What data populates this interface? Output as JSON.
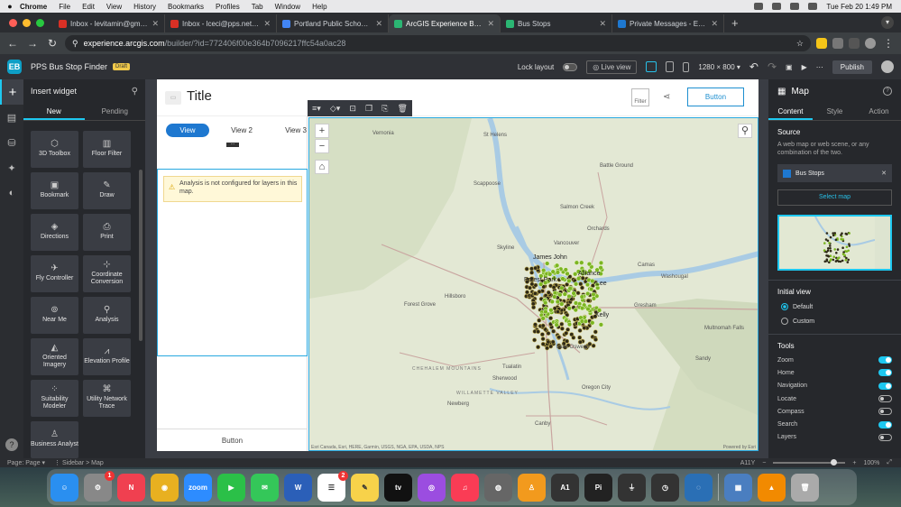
{
  "menubar": {
    "app": "Chrome",
    "menus": [
      "File",
      "Edit",
      "View",
      "History",
      "Bookmarks",
      "Profiles",
      "Tab",
      "Window",
      "Help"
    ],
    "clock": "Tue Feb 20  1:49 PM"
  },
  "tabs": [
    {
      "title": "Inbox - levitamin@gmail.com",
      "color": "#d93025"
    },
    {
      "title": "Inbox - lceci@pps.net - Portl",
      "color": "#d93025"
    },
    {
      "title": "Portland Public Schools - Cal",
      "color": "#4285f4"
    },
    {
      "title": "ArcGIS Experience Builder",
      "color": "#2bb673"
    },
    {
      "title": "Bus Stops",
      "color": "#2bb673"
    },
    {
      "title": "Private Messages - Esri Comm",
      "color": "#1e78d0"
    }
  ],
  "address": {
    "host": "experience.arcgis.com",
    "path": "/builder/?id=772406f00e364b7096217ffc54a0ac28"
  },
  "builder": {
    "app_name": "PPS Bus Stop Finder",
    "draft_label": "Draft",
    "lock_layout_label": "Lock layout",
    "live_view_label": "Live view",
    "resolution": "1280 × 800",
    "publish_label": "Publish"
  },
  "insert": {
    "title": "Insert widget",
    "tab_new": "New",
    "tab_pending": "Pending",
    "widgets": [
      {
        "label": "3D Toolbox",
        "icon": "cube-icon",
        "glyph": "⬡"
      },
      {
        "label": "Floor Filter",
        "icon": "building-icon",
        "glyph": "▥"
      },
      {
        "label": "Bookmark",
        "icon": "bookmark-icon",
        "glyph": "▣"
      },
      {
        "label": "Draw",
        "icon": "draw-icon",
        "glyph": "✎"
      },
      {
        "label": "Directions",
        "icon": "directions-icon",
        "glyph": "◈"
      },
      {
        "label": "Print",
        "icon": "print-icon",
        "glyph": "⎙"
      },
      {
        "label": "Fly Controller",
        "icon": "plane-icon",
        "glyph": "✈"
      },
      {
        "label": "Coordinate Conversion",
        "icon": "coordinate-icon",
        "glyph": "⊹"
      },
      {
        "label": "Near Me",
        "icon": "near-me-icon",
        "glyph": "⊚"
      },
      {
        "label": "Analysis",
        "icon": "analysis-icon",
        "glyph": "⚲"
      },
      {
        "label": "Oriented Imagery",
        "icon": "oriented-imagery-icon",
        "glyph": "◭"
      },
      {
        "label": "Elevation Profile",
        "icon": "elevation-icon",
        "glyph": "⩘"
      },
      {
        "label": "Suitability Modeler",
        "icon": "suitability-icon",
        "glyph": "⁘"
      },
      {
        "label": "Utility Network Trace",
        "icon": "utility-trace-icon",
        "glyph": "⌘"
      },
      {
        "label": "Business Analyst",
        "icon": "business-analyst-icon",
        "glyph": "♙"
      }
    ]
  },
  "page": {
    "title": "Title",
    "logo_placeholder": "▭",
    "filter_label": "Filter",
    "button_label": "Button",
    "views": [
      "View",
      "View 2",
      "View 3"
    ],
    "warning": "Analysis is not configured for layers in this map.",
    "sidebar_button": "Button"
  },
  "map": {
    "labels": [
      {
        "text": "Vernonia",
        "kind": "town"
      },
      {
        "text": "St Helens",
        "kind": "town"
      },
      {
        "text": "Battle Ground",
        "kind": "town"
      },
      {
        "text": "Scappoose",
        "kind": "town"
      },
      {
        "text": "Salmon Creek",
        "kind": "town"
      },
      {
        "text": "Orchards",
        "kind": "town"
      },
      {
        "text": "Skyline",
        "kind": "town"
      },
      {
        "text": "Vancouver",
        "kind": "town"
      },
      {
        "text": "James John",
        "kind": "city"
      },
      {
        "text": "Alliance",
        "kind": "city"
      },
      {
        "text": "Camas",
        "kind": "town"
      },
      {
        "text": "Washougal",
        "kind": "town"
      },
      {
        "text": "Forest Park",
        "kind": "city"
      },
      {
        "text": "Lee",
        "kind": "city"
      },
      {
        "text": "Hillsboro",
        "kind": "town"
      },
      {
        "text": "Forest Grove",
        "kind": "town"
      },
      {
        "text": "Gresham",
        "kind": "town"
      },
      {
        "text": "Kelly",
        "kind": "city"
      },
      {
        "text": "Lake Oswego",
        "kind": "town"
      },
      {
        "text": "CHEHALEM MOUNTAINS",
        "kind": "region"
      },
      {
        "text": "Tualatin",
        "kind": "town"
      },
      {
        "text": "Sandy",
        "kind": "town"
      },
      {
        "text": "Sherwood",
        "kind": "town"
      },
      {
        "text": "WILLAMETTE VALLEY",
        "kind": "region"
      },
      {
        "text": "Oregon City",
        "kind": "town"
      },
      {
        "text": "Newberg",
        "kind": "town"
      },
      {
        "text": "Canby",
        "kind": "town"
      },
      {
        "text": "Multnomah Falls",
        "kind": "town"
      }
    ],
    "attribution": "Esri Canada, Esri, HERE, Garmin, USGS, NGA, EPA, USDA, NPS",
    "powered_by": "Powered by Esri",
    "zoom_in": "+",
    "zoom_out": "−",
    "home": "⌂",
    "search": "⚲"
  },
  "props": {
    "widget_name": "Map",
    "tabs": [
      "Content",
      "Style",
      "Action"
    ],
    "source_title": "Source",
    "source_desc": "A web map or web scene, or any combination of the two.",
    "data_source": "Bus Stops",
    "select_map": "Select map",
    "initial_view_title": "Initial view",
    "initial_default": "Default",
    "initial_custom": "Custom",
    "tools_title": "Tools",
    "tools": [
      {
        "label": "Zoom",
        "on": true
      },
      {
        "label": "Home",
        "on": true
      },
      {
        "label": "Navigation",
        "on": true
      },
      {
        "label": "Locate",
        "on": false
      },
      {
        "label": "Compass",
        "on": false
      },
      {
        "label": "Search",
        "on": true
      },
      {
        "label": "Layers",
        "on": false
      }
    ]
  },
  "status": {
    "page_label": "Page:",
    "page_value": "Page",
    "crumbs": [
      "Sidebar",
      "Map"
    ],
    "zoom_label": "A11Y",
    "zoom_value": "100%"
  },
  "dock": {
    "apps": [
      {
        "name": "finder",
        "glyph": "☺",
        "color": "#2a8ff0"
      },
      {
        "name": "system-settings",
        "glyph": "⚙",
        "color": "#888",
        "badge": "1"
      },
      {
        "name": "news",
        "glyph": "N",
        "color": "#f04050"
      },
      {
        "name": "chrome",
        "glyph": "◉",
        "color": "#e8b020"
      },
      {
        "name": "zoom",
        "glyph": "zoom",
        "color": "#2d8cff"
      },
      {
        "name": "facetime",
        "glyph": "▶",
        "color": "#2bc048"
      },
      {
        "name": "messages",
        "glyph": "✉",
        "color": "#34c759"
      },
      {
        "name": "word",
        "glyph": "W",
        "color": "#2b5fb8"
      },
      {
        "name": "reminders",
        "glyph": "☰",
        "color": "#ffffff",
        "badge": "2"
      },
      {
        "name": "notes",
        "glyph": "✎",
        "color": "#f7d24a"
      },
      {
        "name": "apple-tv",
        "glyph": "tv",
        "color": "#111111"
      },
      {
        "name": "podcasts",
        "glyph": "◎",
        "color": "#9b4de0"
      },
      {
        "name": "music",
        "glyph": "♫",
        "color": "#fa3c55"
      },
      {
        "name": "disk-utility",
        "glyph": "◍",
        "color": "#666"
      },
      {
        "name": "keynote",
        "glyph": "♙",
        "color": "#f29a1d"
      },
      {
        "name": "affinity",
        "glyph": "A1",
        "color": "#333"
      },
      {
        "name": "pixelmator",
        "glyph": "Pi",
        "color": "#222"
      },
      {
        "name": "instruments",
        "glyph": "⏚",
        "color": "#333"
      },
      {
        "name": "time-tool",
        "glyph": "◷",
        "color": "#333"
      },
      {
        "name": "safari-tool",
        "glyph": "◌",
        "color": "#2a6fb5"
      },
      {
        "name": "preview",
        "glyph": "▦",
        "color": "#4a7ec0"
      },
      {
        "name": "vlc",
        "glyph": "▲",
        "color": "#f28a00"
      },
      {
        "name": "trash",
        "glyph": "🗑",
        "color": "#aaa"
      }
    ]
  }
}
